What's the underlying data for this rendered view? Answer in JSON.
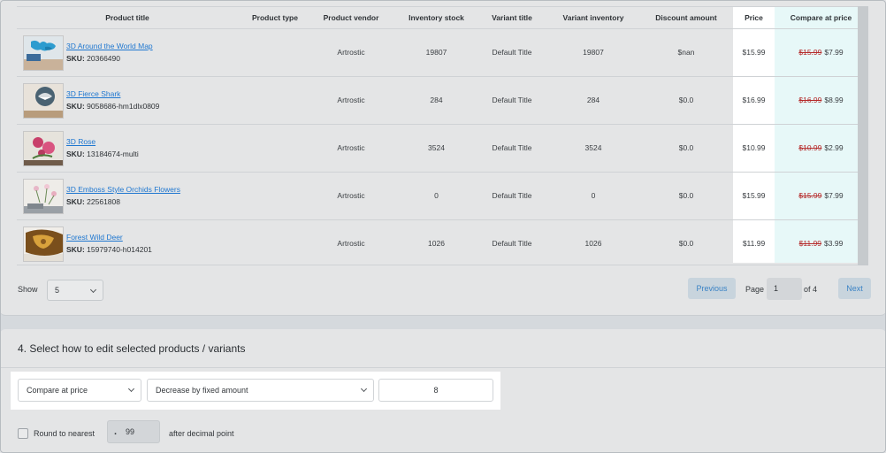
{
  "table": {
    "headers": [
      "Product title",
      "Product type",
      "Product vendor",
      "Inventory stock",
      "Variant title",
      "Variant inventory",
      "Discount amount",
      "Price",
      "Compare at price"
    ],
    "sku_label": "SKU:",
    "rows": [
      {
        "title": "3D Around the World Map",
        "sku": "20366490",
        "type": "",
        "vendor": "Artrostic",
        "stock": "19807",
        "variant": "Default Title",
        "variant_inv": "19807",
        "discount": "$nan",
        "price": "$15.99",
        "compare_old": "$15.99",
        "compare_new": "$7.99"
      },
      {
        "title": "3D Fierce Shark",
        "sku": "9058686-hm1dlx0809",
        "type": "",
        "vendor": "Artrostic",
        "stock": "284",
        "variant": "Default Title",
        "variant_inv": "284",
        "discount": "$0.0",
        "price": "$16.99",
        "compare_old": "$16.99",
        "compare_new": "$8.99"
      },
      {
        "title": "3D Rose",
        "sku": "13184674-multi",
        "type": "",
        "vendor": "Artrostic",
        "stock": "3524",
        "variant": "Default Title",
        "variant_inv": "3524",
        "discount": "$0.0",
        "price": "$10.99",
        "compare_old": "$10.99",
        "compare_new": "$2.99"
      },
      {
        "title": "3D Emboss Style Orchids Flowers",
        "sku": "22561808",
        "type": "",
        "vendor": "Artrostic",
        "stock": "0",
        "variant": "Default Title",
        "variant_inv": "0",
        "discount": "$0.0",
        "price": "$15.99",
        "compare_old": "$15.99",
        "compare_new": "$7.99"
      },
      {
        "title": "Forest Wild Deer",
        "sku": "15979740-h014201",
        "type": "",
        "vendor": "Artrostic",
        "stock": "1026",
        "variant": "Default Title",
        "variant_inv": "1026",
        "discount": "$0.0",
        "price": "$11.99",
        "compare_old": "$11.99",
        "compare_new": "$3.99"
      }
    ]
  },
  "pagination": {
    "show_label": "Show",
    "show_value": "5",
    "previous": "Previous",
    "page_label": "Page",
    "page_value": "1",
    "of_label": "of 4",
    "next": "Next"
  },
  "section4": {
    "title": "4. Select how to edit selected products / variants",
    "field_select": "Compare at price",
    "method_select": "Decrease by fixed amount",
    "amount_value": "8",
    "round_label": "Round to nearest",
    "decimal_dot": ".",
    "decimal_value": "99",
    "after_label": "after decimal point"
  },
  "colors": {
    "link": "#1f77d0",
    "strike": "#b52a2a",
    "price_highlight": "#ffffff",
    "compare_highlight": "#e7f8f8",
    "button_text": "#3b83c5"
  },
  "icons": [
    "chevron-down-icon",
    "product-thumbnail-image"
  ]
}
